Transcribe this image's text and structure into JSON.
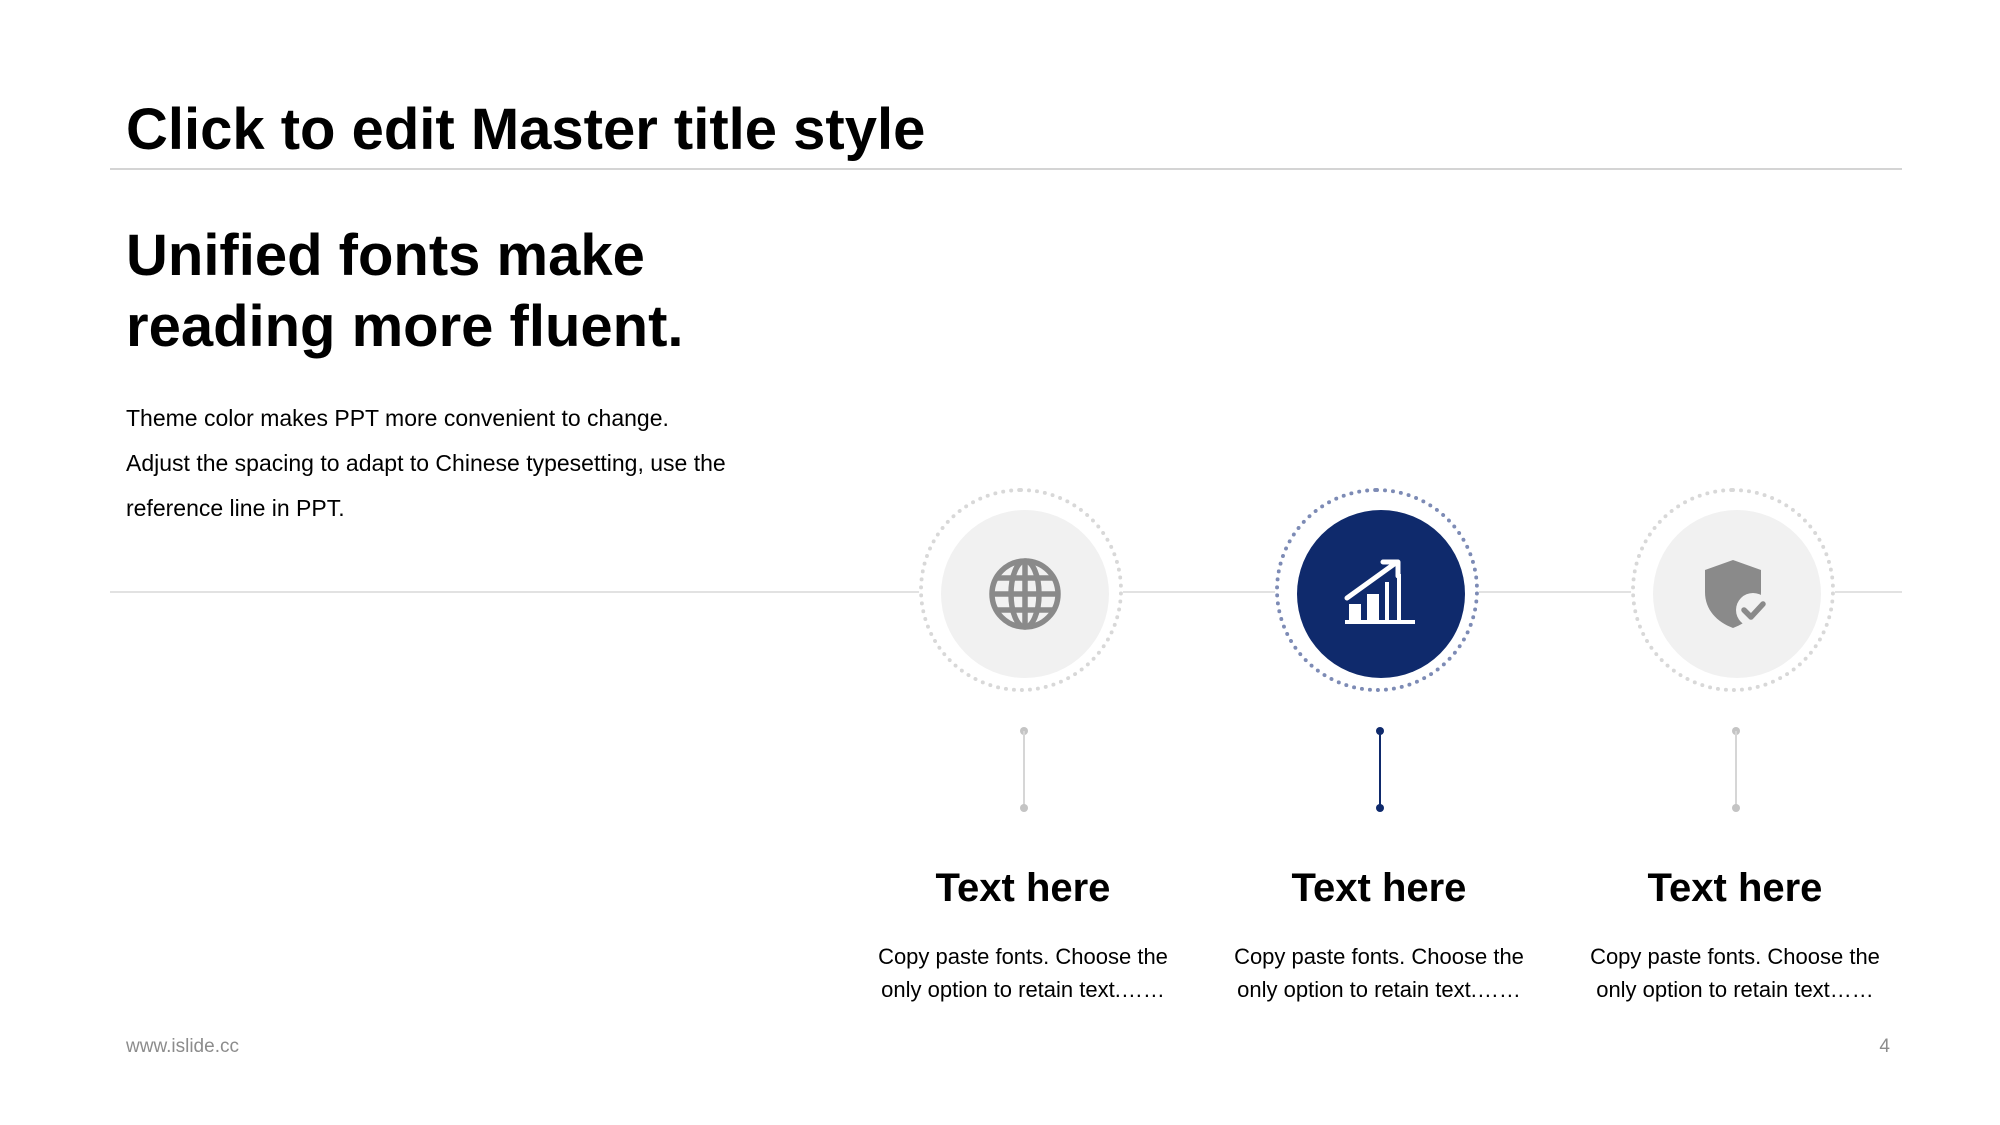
{
  "slide": {
    "master_title": "Click to edit Master title style",
    "headline": "Unified fonts make reading more fluent.",
    "body_lines": [
      "Theme color makes PPT more convenient to change.",
      "Adjust the spacing to adapt to Chinese typesetting, use the",
      "reference line in PPT."
    ]
  },
  "steps": [
    {
      "icon": "globe-icon",
      "title": "Text here",
      "desc_lines": [
        "Copy paste fonts. Choose the",
        "only option to retain text.……"
      ],
      "active": false
    },
    {
      "icon": "growth-chart-icon",
      "title": "Text here",
      "desc_lines": [
        "Copy paste fonts. Choose the",
        "only option to retain text.……"
      ],
      "active": true
    },
    {
      "icon": "shield-check-icon",
      "title": "Text here",
      "desc_lines": [
        "Copy paste fonts. Choose the",
        "only option to retain text……"
      ],
      "active": false
    }
  ],
  "colors": {
    "accent": "#0f2a6c",
    "icon_gray": "#8a8a8a",
    "disc_gray": "#f1f1f1"
  },
  "footer": {
    "url": "www.islide.cc",
    "page_number": "4"
  }
}
